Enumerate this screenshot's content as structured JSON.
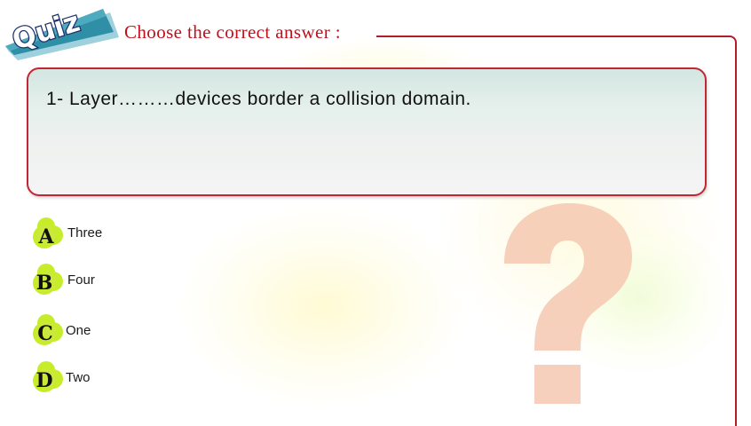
{
  "quiz_badge": {
    "label": "Quiz"
  },
  "heading": "Choose the correct answer :",
  "question": {
    "text": "1- Layer………devices border a collision domain."
  },
  "options": [
    {
      "letter": "A",
      "text": "Three"
    },
    {
      "letter": "B",
      "text": "Four"
    },
    {
      "letter": "C",
      "text": "One"
    },
    {
      "letter": "D",
      "text": "Two"
    }
  ],
  "colors": {
    "accent_red": "#c0101c",
    "badge_teal": "#2f8fa6",
    "bullet_green": "#c6ec2a",
    "question_mark": "#f6c9b3"
  },
  "icons": {
    "decoration": "question-mark-icon"
  }
}
